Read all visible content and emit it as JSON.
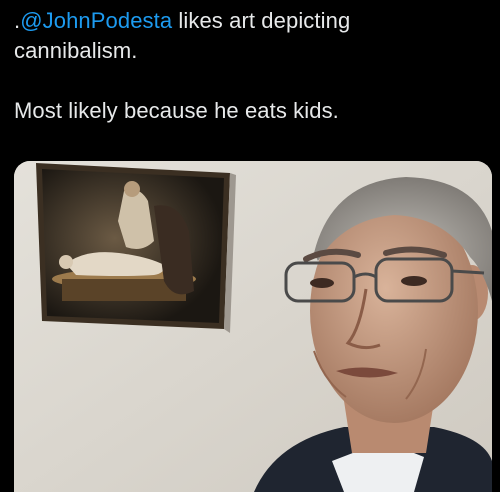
{
  "tweet": {
    "prefix": ".",
    "mention": "@JohnPodesta",
    "line1_rest": " likes art depicting",
    "line2": "cannibalism.",
    "line3": "Most likely because he eats kids."
  },
  "colors": {
    "mention": "#1d9bf0",
    "text": "#e7e9ea",
    "background": "#000000",
    "wall": "#ddd9d1"
  },
  "media": {
    "icon": "photo"
  }
}
